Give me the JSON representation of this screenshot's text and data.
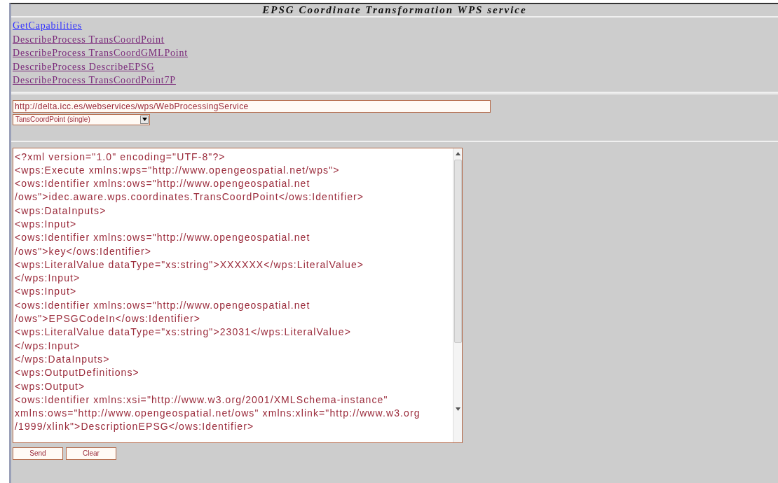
{
  "header": {
    "title": "EPSG Coordinate Transformation WPS service"
  },
  "links": [
    {
      "label": "GetCapabilities",
      "visited": false
    },
    {
      "label": "DescribeProcess TransCoordPoint",
      "visited": true
    },
    {
      "label": "DescribeProcess TransCoordGMLPoint",
      "visited": true
    },
    {
      "label": "DescribeProcess DescribeEPSG",
      "visited": true
    },
    {
      "label": "DescribeProcess TransCoordPoint7P",
      "visited": true
    }
  ],
  "service_url": {
    "value": "http://delta.icc.es/webservices/wps/WebProcessingService"
  },
  "process_select": {
    "value": "TansCoordPoint (single)"
  },
  "request_xml": {
    "lines": [
      "<?xml version=\"1.0\" encoding=\"UTF-8\"?>",
      "<wps:Execute xmlns:wps=\"http://www.opengeospatial.net/wps\">",
      "<ows:Identifier xmlns:ows=\"http://www.opengeospatial.net",
      "/ows\">idec.aware.wps.coordinates.TransCoordPoint</ows:Identifier>",
      "<wps:DataInputs>",
      "<wps:Input>",
      "<ows:Identifier xmlns:ows=\"http://www.opengeospatial.net",
      "/ows\">key</ows:Identifier>",
      "<wps:LiteralValue dataType=\"xs:string\">XXXXXX</wps:LiteralValue>",
      "</wps:Input>",
      "<wps:Input>",
      "<ows:Identifier xmlns:ows=\"http://www.opengeospatial.net",
      "/ows\">EPSGCodeIn</ows:Identifier>",
      "<wps:LiteralValue dataType=\"xs:string\">23031</wps:LiteralValue>",
      "</wps:Input>",
      "</wps:DataInputs>",
      "<wps:OutputDefinitions>",
      "<wps:Output>",
      "<ows:Identifier xmlns:xsi=\"http://www.w3.org/2001/XMLSchema-instance\"",
      "xmlns:ows=\"http://www.opengeospatial.net/ows\" xmlns:xlink=\"http://www.w3.org",
      "/1999/xlink\">DescriptionEPSG</ows:Identifier>"
    ]
  },
  "buttons": [
    "Send",
    "Clear"
  ]
}
